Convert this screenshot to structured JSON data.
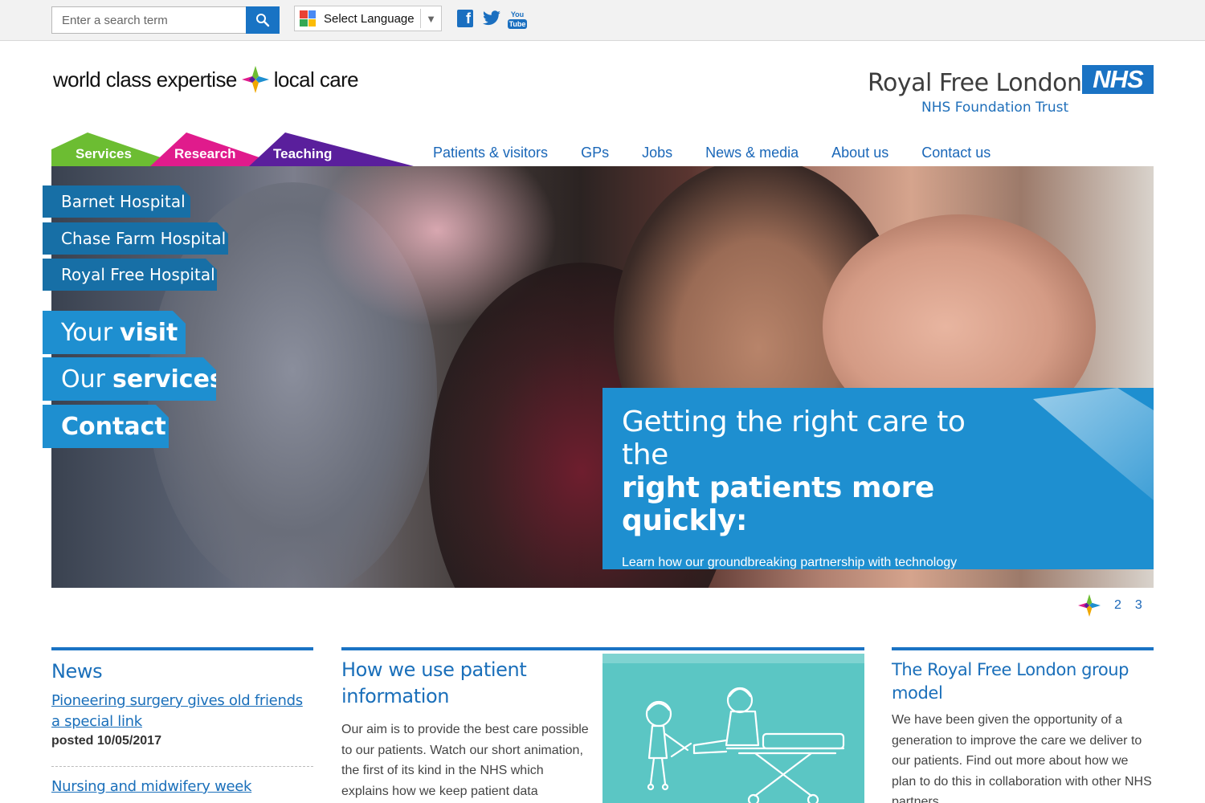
{
  "topbar": {
    "search_placeholder": "Enter a search term",
    "language_label": "Select Language",
    "social": [
      "facebook-icon",
      "twitter-icon",
      "youtube-icon"
    ],
    "youtube_top": "You",
    "youtube_bottom": "Tube"
  },
  "header": {
    "tagline_left": "world class expertise",
    "tagline_right": "local care",
    "org_name": "Royal Free London",
    "org_sub": "NHS Foundation Trust",
    "nhs_logo": "NHS"
  },
  "tabs": [
    "Services",
    "Research",
    "Teaching"
  ],
  "nav": [
    "Patients & visitors",
    "GPs",
    "Jobs",
    "News & media",
    "About us",
    "Contact us"
  ],
  "hospitals": [
    "Barnet Hospital",
    "Chase Farm Hospital",
    "Royal Free Hospital"
  ],
  "quick_links": [
    {
      "light": "Your",
      "bold": "visit"
    },
    {
      "light": "Our",
      "bold": "services"
    },
    {
      "bold": "Contact"
    }
  ],
  "hero": {
    "heading_light": "Getting the right care to the",
    "heading_bold": "right patients more quickly:",
    "text": "Learn how our groundbreaking partnership with technology company DeepMind is helping patients like Afia"
  },
  "pager": [
    "2",
    "3"
  ],
  "news": {
    "title": "News",
    "items": [
      {
        "title": "Pioneering surgery gives old friends a special link",
        "date": "posted 10/05/2017"
      },
      {
        "title": "Nursing and midwifery week"
      }
    ]
  },
  "patient_info": {
    "title": "How we use patient information",
    "body": "Our aim is to provide the best care possible to our patients. Watch our short animation, the first of its kind in the NHS which explains how we keep patient data"
  },
  "group_model": {
    "title": "The Royal Free London group model",
    "body": "We have been given the opportunity of a generation to improve the care we deliver to our patients. Find out more about how we plan to do this in collaboration with other NHS partners."
  },
  "colors": {
    "nhs_blue": "#1a73c4",
    "services_green": "#6cbd32",
    "research_pink": "#e01b8c",
    "teaching_purple": "#5a1f9c",
    "hero_card_blue": "#1e8fd0",
    "hospital_link_blue": "#176fa6",
    "video_teal": "#5bc6c4"
  }
}
